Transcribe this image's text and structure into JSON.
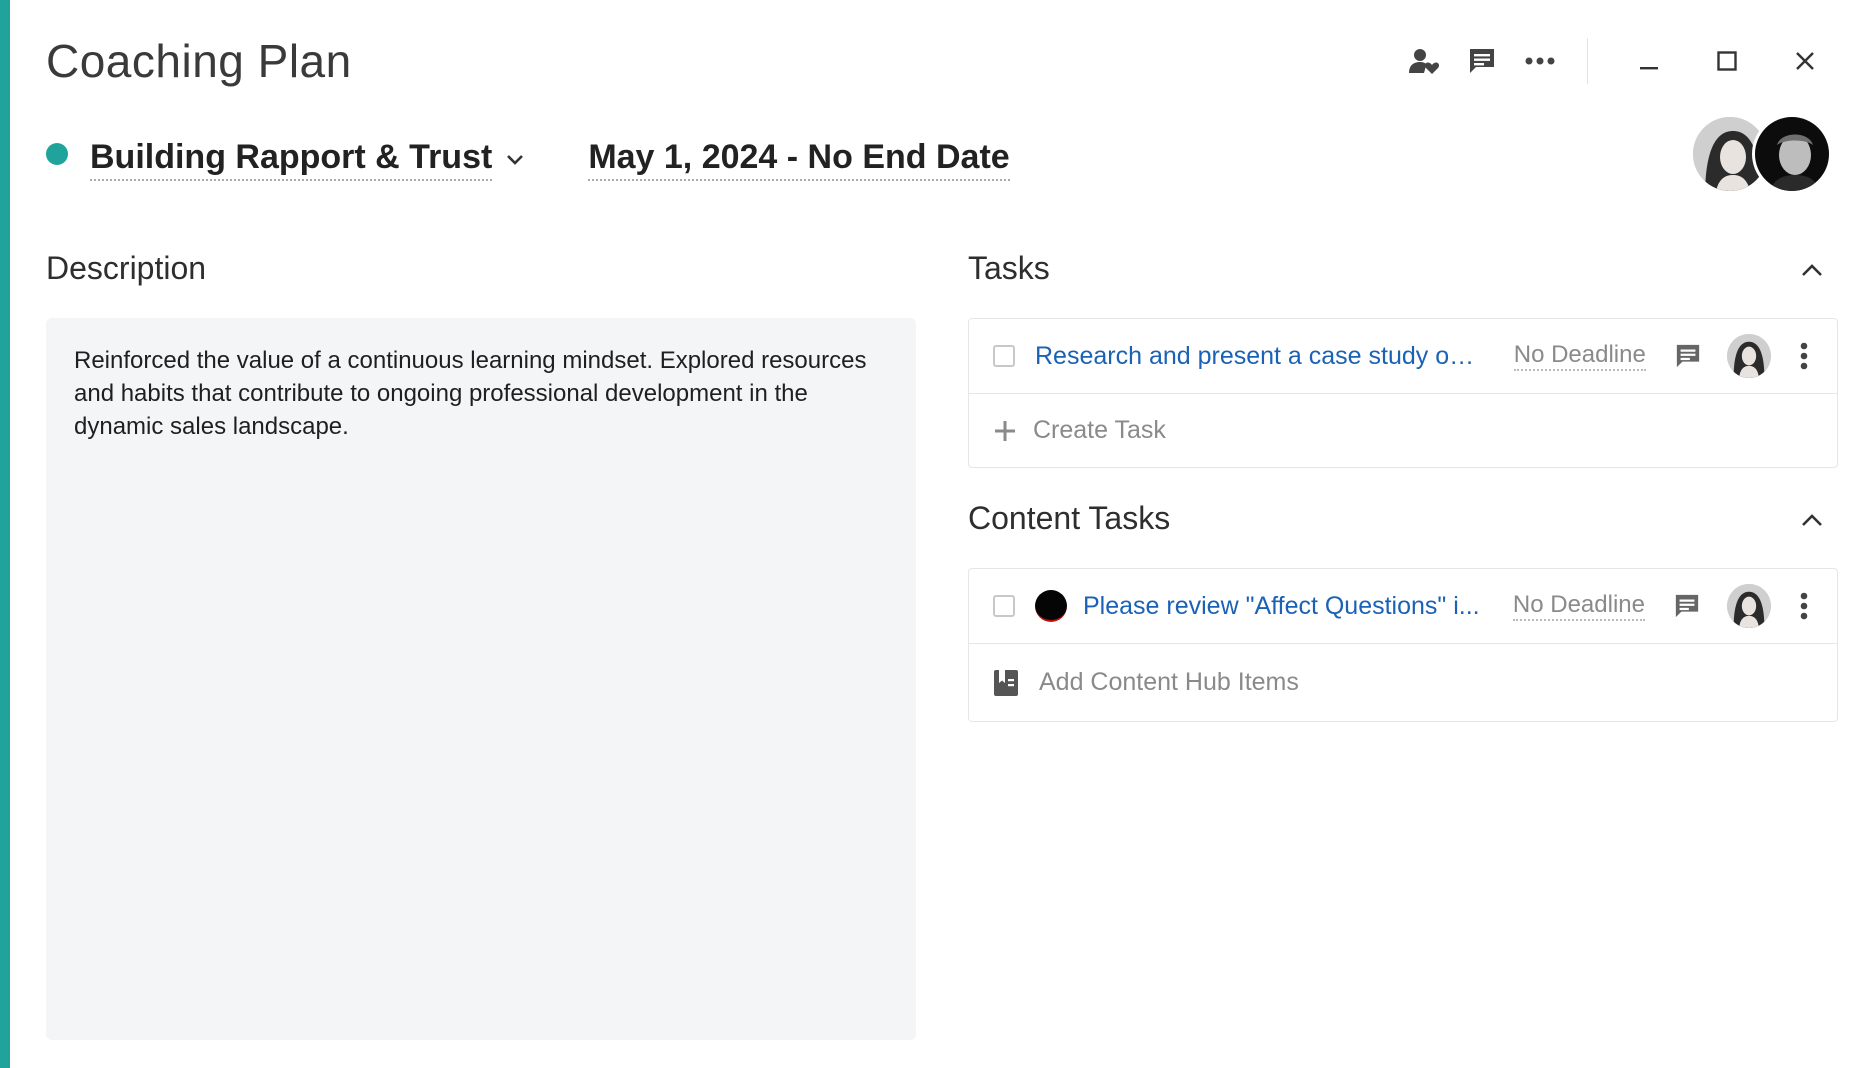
{
  "window": {
    "title": "Coaching Plan",
    "actions": {
      "participants_icon": "people-heart-icon",
      "comments_icon": "comment-icon",
      "more_icon": "more-horizontal-icon"
    },
    "controls": {
      "minimize_icon": "minimize-icon",
      "maximize_icon": "maximize-icon",
      "close_icon": "close-icon"
    }
  },
  "plan": {
    "status_color": "#1fa39a",
    "name": "Building Rapport & Trust",
    "date_range": "May 1, 2024 - No End Date"
  },
  "description": {
    "heading": "Description",
    "text": "Reinforced the value of a continuous learning mindset. Explored resources and habits that contribute to ongoing professional development in the dynamic sales landscape."
  },
  "tasks": {
    "heading": "Tasks",
    "items": [
      {
        "title": "Research and present a case study on ...",
        "deadline": "No Deadline"
      }
    ],
    "create_label": "Create Task"
  },
  "content_tasks": {
    "heading": "Content Tasks",
    "items": [
      {
        "title": "Please review \"Affect Questions\" i...",
        "deadline": "No Deadline"
      }
    ],
    "add_label": "Add Content Hub Items"
  },
  "colors": {
    "accent": "#1fa39a",
    "link": "#1a62b5"
  }
}
